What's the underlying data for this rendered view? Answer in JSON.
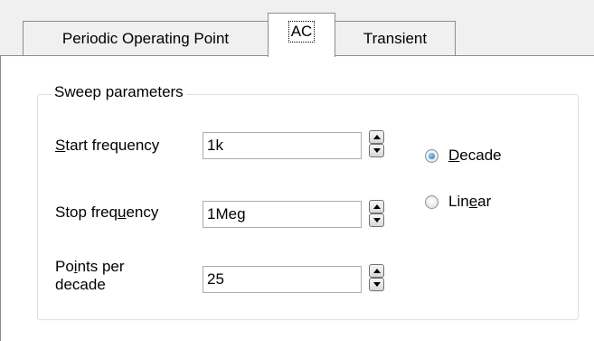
{
  "tabs": [
    {
      "label": "Periodic Operating Point",
      "active": false
    },
    {
      "label": "AC",
      "active": true
    },
    {
      "label": "Transient",
      "active": false
    }
  ],
  "sweep": {
    "group_title": "Sweep parameters",
    "start_frequency": {
      "label_mnemonic": "S",
      "label_rest": "tart frequency",
      "value": "1k"
    },
    "stop_frequency": {
      "label_pre": "Stop freq",
      "label_mnemonic": "u",
      "label_post": "ency",
      "value": "1Meg"
    },
    "points_per_decade": {
      "label_line1_pre": "Po",
      "label_line1_mnemonic": "i",
      "label_line1_post": "nts per",
      "label_line2": "decade",
      "value": "25"
    },
    "scale_options": [
      {
        "label_mnemonic": "D",
        "label_rest": "ecade",
        "selected": true
      },
      {
        "label_pre": "Lin",
        "label_mnemonic": "e",
        "label_post": "ar",
        "selected": false
      }
    ]
  },
  "colors": {
    "tab_border": "#898c95",
    "group_border": "#d5dfe5",
    "radio_selected": "#1b6fb4"
  }
}
